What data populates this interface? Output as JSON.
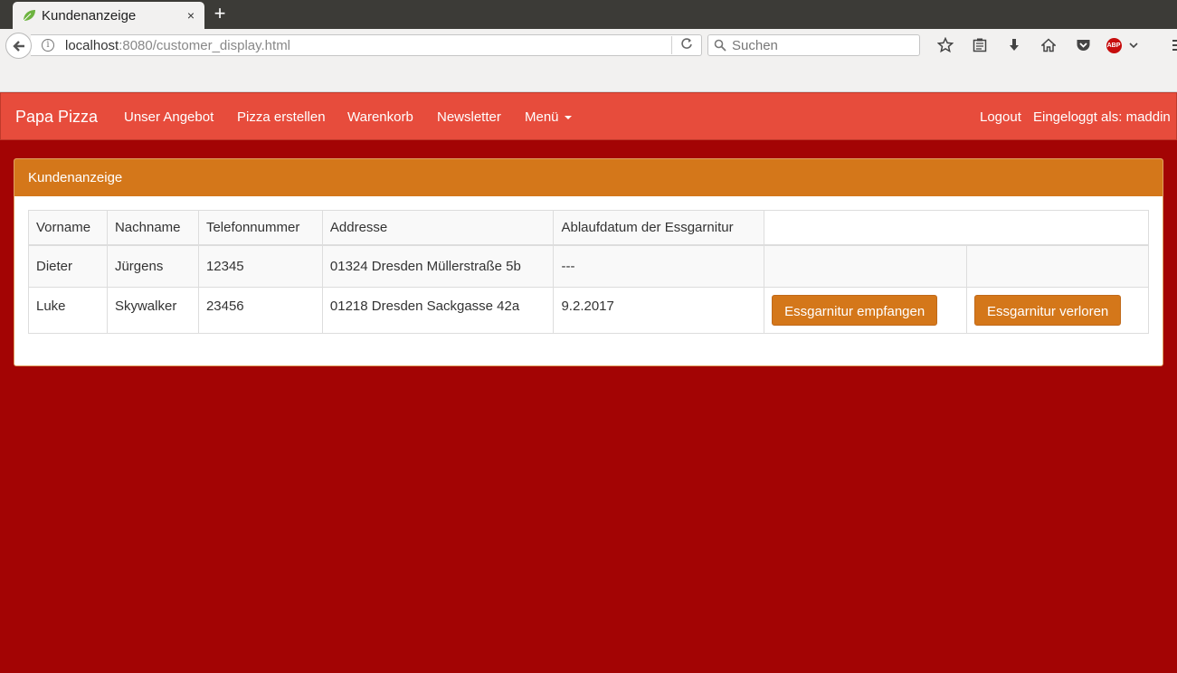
{
  "browser": {
    "tab_title": "Kundenanzeige",
    "tab_close": "×",
    "new_tab": "+",
    "url_host": "localhost",
    "url_rest": ":8080/customer_display.html",
    "search_placeholder": "Suchen",
    "abp_label": "ABP"
  },
  "nav": {
    "brand": "Papa Pizza",
    "items": [
      "Unser Angebot",
      "Pizza erstellen",
      "Warenkorb",
      "Newsletter",
      "Menü"
    ],
    "logout": "Logout",
    "logged_in_as": "Eingeloggt als: maddin"
  },
  "panel": {
    "title": "Kundenanzeige",
    "table": {
      "headers": [
        "Vorname",
        "Nachname",
        "Telefonnummer",
        "Addresse",
        "Ablaufdatum der Essgarnitur",
        ""
      ],
      "rows": [
        {
          "vorname": "Dieter",
          "nachname": "Jürgens",
          "telefon": "12345",
          "adresse": "01324 Dresden Müllerstraße 5b",
          "ablauf": "---"
        },
        {
          "vorname": "Luke",
          "nachname": "Skywalker",
          "telefon": "23456",
          "adresse": "01218 Dresden Sackgasse 42a",
          "ablauf": "9.2.2017",
          "btn_received": "Essgarnitur empfangen",
          "btn_lost": "Essgarnitur verloren"
        }
      ]
    }
  },
  "colors": {
    "page_bg": "#a30404",
    "navbar_bg": "#e74c3c",
    "panel_heading": "#d4771a",
    "button": "#d4771a"
  }
}
